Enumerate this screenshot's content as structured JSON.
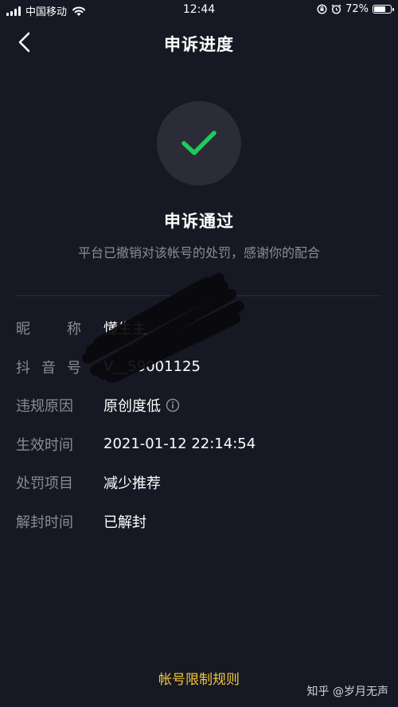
{
  "status_bar": {
    "carrier": "中国移动",
    "time": "12:44",
    "battery": "72%",
    "battery_level": 0.72
  },
  "nav": {
    "title": "申诉进度"
  },
  "result": {
    "title": "申诉通过",
    "description": "平台已撤销对该帐号的处罚，感谢你的配合"
  },
  "info": [
    {
      "label_chars": [
        "昵",
        "称"
      ],
      "label": "昵称",
      "value": "懂生主"
    },
    {
      "label_chars": [
        "抖",
        "音",
        "号"
      ],
      "label": "抖音号",
      "value": "V__59001125"
    },
    {
      "label": "违规原因",
      "value": "原创度低"
    },
    {
      "label": "生效时间",
      "value": "2021-01-12 22:14:54"
    },
    {
      "label": "处罚项目",
      "value": "减少推荐"
    },
    {
      "label": "解封时间",
      "value": "已解封"
    }
  ],
  "footer": {
    "rules_link": "帐号限制规则",
    "watermark": "知乎 @岁月无声"
  },
  "colors": {
    "background": "#161823",
    "accent_green": "#20c95e",
    "link_yellow": "#f2c83a",
    "muted_text": "#8a8b93"
  }
}
